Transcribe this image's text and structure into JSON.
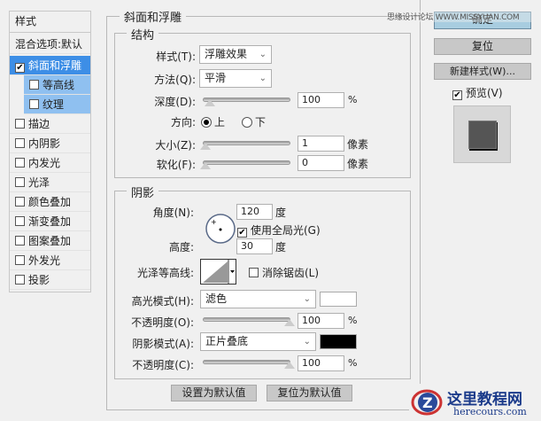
{
  "sidebar": {
    "header": "样式",
    "blend": "混合选项:默认",
    "items": [
      {
        "label": "斜面和浮雕",
        "checked": true
      },
      {
        "label": "等高线",
        "checked": false
      },
      {
        "label": "纹理",
        "checked": false
      },
      {
        "label": "描边",
        "checked": false
      },
      {
        "label": "内阴影",
        "checked": false
      },
      {
        "label": "内发光",
        "checked": false
      },
      {
        "label": "光泽",
        "checked": false
      },
      {
        "label": "颜色叠加",
        "checked": false
      },
      {
        "label": "渐变叠加",
        "checked": false
      },
      {
        "label": "图案叠加",
        "checked": false
      },
      {
        "label": "外发光",
        "checked": false
      },
      {
        "label": "投影",
        "checked": false
      }
    ]
  },
  "panel": {
    "title": "斜面和浮雕",
    "structure": {
      "title": "结构",
      "style_label": "样式(T):",
      "style_value": "浮雕效果",
      "method_label": "方法(Q):",
      "method_value": "平滑",
      "depth_label": "深度(D):",
      "depth_value": "100",
      "depth_unit": "%",
      "depth_fraction": 0.0,
      "direction_label": "方向:",
      "dir_up": "上",
      "dir_down": "下",
      "size_label": "大小(Z):",
      "size_value": "1",
      "size_unit": "像素",
      "soften_label": "软化(F):",
      "soften_value": "0",
      "soften_unit": "像素"
    },
    "shading": {
      "title": "阴影",
      "angle_label": "角度(N):",
      "angle_value": "120",
      "angle_unit": "度",
      "global_light": "使用全局光(G)",
      "altitude_label": "高度:",
      "altitude_value": "30",
      "altitude_unit": "度",
      "gloss_label": "光泽等高线:",
      "antialias": "消除锯齿(L)",
      "highlight_label": "高光模式(H):",
      "highlight_mode": "滤色",
      "highlight_color": "#ffffff",
      "hl_opacity_label": "不透明度(O):",
      "hl_opacity": "100",
      "hl_unit": "%",
      "shadow_label": "阴影模式(A):",
      "shadow_mode": "正片叠底",
      "shadow_color": "#000000",
      "sh_opacity_label": "不透明度(C):",
      "sh_opacity": "100",
      "sh_unit": "%"
    },
    "make_default": "设置为默认值",
    "reset_default": "复位为默认值"
  },
  "right": {
    "ok": "确定",
    "reset": "复位",
    "new_style": "新建样式(W)...",
    "preview": "预览(V)"
  },
  "watermark": {
    "top": "思缘设计论坛 WWW.MISSYUAN.COM",
    "logo_cn": "这里教程网",
    "logo_en": "herecours.com"
  }
}
